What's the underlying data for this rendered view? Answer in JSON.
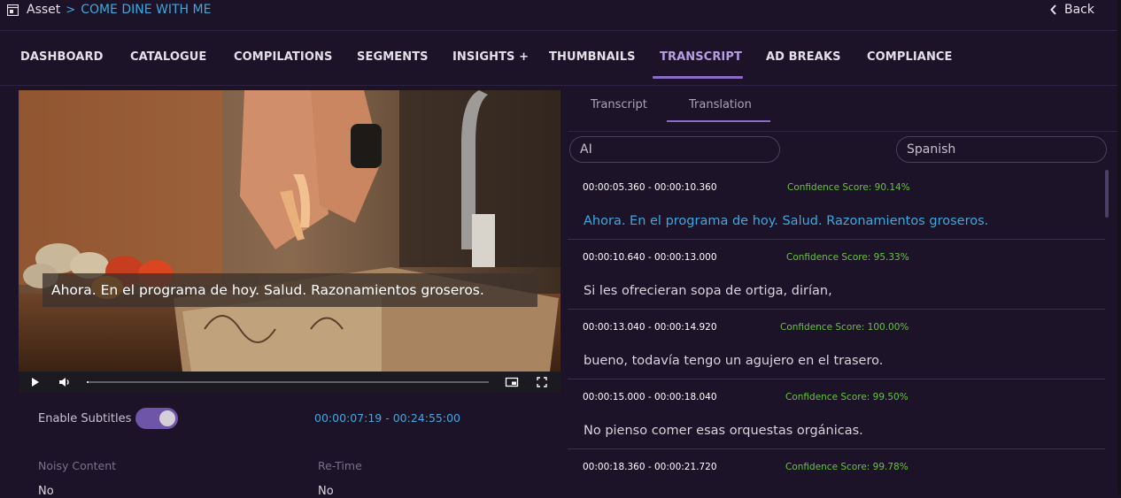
{
  "breadcrumb": {
    "root": "Asset",
    "separator": ">",
    "title": "COME DINE WITH ME"
  },
  "back_label": "Back",
  "nav": {
    "tabs": [
      {
        "label": "DASHBOARD"
      },
      {
        "label": "CATALOGUE"
      },
      {
        "label": "COMPILATIONS"
      },
      {
        "label": "SEGMENTS"
      },
      {
        "label": "INSIGHTS +"
      },
      {
        "label": "THUMBNAILS"
      },
      {
        "label": "TRANSCRIPT",
        "active": true
      },
      {
        "label": "AD BREAKS"
      },
      {
        "label": "COMPLIANCE"
      }
    ]
  },
  "player": {
    "subtitle": "Ahora. En el programa de hoy. Salud. Razonamientos groseros.",
    "progress_fraction": 0.005
  },
  "options": {
    "enable_subtitles_label": "Enable Subtitles",
    "enable_subtitles": true,
    "timecode": "00:00:07:19 - 00:24:55:00",
    "noisy_content_label": "Noisy Content",
    "noisy_content_value": "No",
    "retime_label": "Re-Time",
    "retime_value": "No"
  },
  "panel": {
    "tabs": [
      {
        "label": "Transcript"
      },
      {
        "label": "Translation",
        "active": true
      }
    ],
    "source_field": "AI",
    "language_field": "Spanish",
    "segments": [
      {
        "time": "00:00:05.360 - 00:00:10.360",
        "confidence": "Confidence Score: 90.14%",
        "text": "Ahora. En el programa de hoy. Salud. Razonamientos groseros.",
        "active": true
      },
      {
        "time": "00:00:10.640 - 00:00:13.000",
        "confidence": "Confidence Score: 95.33%",
        "text": "Si les ofrecieran sopa de ortiga, dirían,"
      },
      {
        "time": "00:00:13.040 - 00:00:14.920",
        "confidence": "Confidence Score: 100.00%",
        "text": "bueno, todavía tengo un agujero en el trasero."
      },
      {
        "time": "00:00:15.000 - 00:00:18.040",
        "confidence": "Confidence Score: 99.50%",
        "text": "No pienso comer esas orquestas orgánicas."
      },
      {
        "time": "00:00:18.360 - 00:00:21.720",
        "confidence": "Confidence Score: 99.78%",
        "text": ""
      }
    ]
  },
  "colors": {
    "accent": "#8a6bc6",
    "link": "#3ea8de",
    "confidence": "#6ac13f",
    "background": "#1c1328"
  }
}
